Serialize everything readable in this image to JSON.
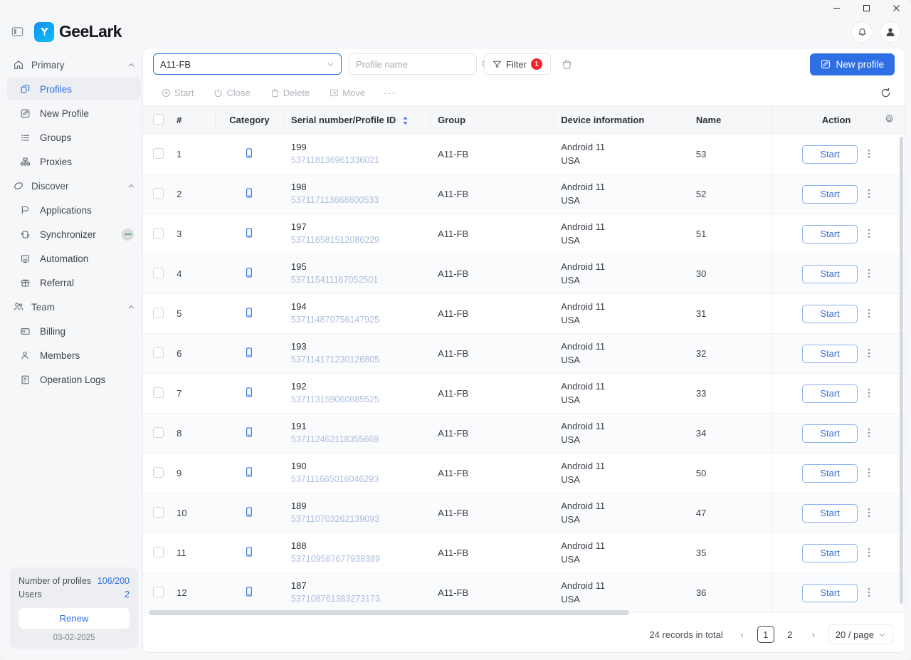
{
  "window": {
    "minimize": "minimize-icon",
    "maximize": "maximize-icon",
    "close": "close-icon"
  },
  "header": {
    "panel_toggle_icon": "panel-toggle-icon",
    "brand": "GeeLark",
    "notifications_icon": "bell-icon",
    "account_icon": "user-icon"
  },
  "sidebar": {
    "groups": [
      {
        "label": "Primary",
        "icon": "home-icon",
        "expanded": true,
        "items": [
          {
            "label": "Profiles",
            "icon": "profiles-icon",
            "active": true
          },
          {
            "label": "New Profile",
            "icon": "new-profile-icon",
            "active": false
          },
          {
            "label": "Groups",
            "icon": "groups-icon",
            "active": false
          },
          {
            "label": "Proxies",
            "icon": "proxies-icon",
            "active": false
          }
        ]
      },
      {
        "label": "Discover",
        "icon": "discover-icon",
        "expanded": true,
        "items": [
          {
            "label": "Applications",
            "icon": "applications-icon",
            "active": false
          },
          {
            "label": "Synchronizer",
            "icon": "synchronizer-icon",
            "active": false,
            "badge": "sync-status-badge"
          },
          {
            "label": "Automation",
            "icon": "automation-icon",
            "active": false
          },
          {
            "label": "Referral",
            "icon": "referral-icon",
            "active": false
          }
        ]
      },
      {
        "label": "Team",
        "icon": "team-icon",
        "expanded": true,
        "items": [
          {
            "label": "Billing",
            "icon": "billing-icon",
            "active": false
          },
          {
            "label": "Members",
            "icon": "members-icon",
            "active": false
          },
          {
            "label": "Operation Logs",
            "icon": "operation-logs-icon",
            "active": false
          }
        ]
      }
    ],
    "quota": {
      "profiles_label": "Number of profiles",
      "profiles_value": "106/200",
      "users_label": "Users",
      "users_value": "2",
      "renew_label": "Renew",
      "expiry_date": "03-02-2025"
    }
  },
  "toolbar": {
    "group_filter_value": "A11-FB",
    "profile_name_placeholder": "Profile name",
    "profile_name_value": "",
    "search_icon": "search-icon",
    "filter_label": "Filter",
    "filter_count": "1",
    "filter_icon": "filter-icon",
    "recycle_icon": "recycle-bin-icon",
    "new_profile_label": "New profile",
    "new_profile_icon": "edit-square-icon"
  },
  "actions": {
    "items": [
      {
        "label": "Start",
        "icon": "play-circle-icon"
      },
      {
        "label": "Close",
        "icon": "power-icon"
      },
      {
        "label": "Delete",
        "icon": "trash-icon"
      },
      {
        "label": "Move",
        "icon": "move-icon"
      }
    ],
    "more": "···",
    "refresh_icon": "refresh-icon"
  },
  "table": {
    "columns": [
      "#",
      "Category",
      "Serial number/Profile ID",
      "Group",
      "Device information",
      "Name",
      "Action"
    ],
    "sort_icon": "sort-arrows-icon",
    "settings_icon": "gear-icon",
    "row_start_label": "Start",
    "row_menu_icon": "kebab-menu-icon",
    "category_icon": "phone-icon",
    "rows": [
      {
        "num": "1",
        "serial": "199",
        "profile_id": "537118136961336021",
        "group": "A11-FB",
        "os": "Android 11",
        "country": "USA",
        "name": "53"
      },
      {
        "num": "2",
        "serial": "198",
        "profile_id": "537117113668600533",
        "group": "A11-FB",
        "os": "Android 11",
        "country": "USA",
        "name": "52"
      },
      {
        "num": "3",
        "serial": "197",
        "profile_id": "537116581512086229",
        "group": "A11-FB",
        "os": "Android 11",
        "country": "USA",
        "name": "51"
      },
      {
        "num": "4",
        "serial": "195",
        "profile_id": "537115411167052501",
        "group": "A11-FB",
        "os": "Android 11",
        "country": "USA",
        "name": "30"
      },
      {
        "num": "5",
        "serial": "194",
        "profile_id": "537114870756147925",
        "group": "A11-FB",
        "os": "Android 11",
        "country": "USA",
        "name": "31"
      },
      {
        "num": "6",
        "serial": "193",
        "profile_id": "537114171230126805",
        "group": "A11-FB",
        "os": "Android 11",
        "country": "USA",
        "name": "32"
      },
      {
        "num": "7",
        "serial": "192",
        "profile_id": "537113159060685525",
        "group": "A11-FB",
        "os": "Android 11",
        "country": "USA",
        "name": "33"
      },
      {
        "num": "8",
        "serial": "191",
        "profile_id": "537112462118355669",
        "group": "A11-FB",
        "os": "Android 11",
        "country": "USA",
        "name": "34"
      },
      {
        "num": "9",
        "serial": "190",
        "profile_id": "537111665016046293",
        "group": "A11-FB",
        "os": "Android 11",
        "country": "USA",
        "name": "50"
      },
      {
        "num": "10",
        "serial": "189",
        "profile_id": "537110703262139093",
        "group": "A11-FB",
        "os": "Android 11",
        "country": "USA",
        "name": "47"
      },
      {
        "num": "11",
        "serial": "188",
        "profile_id": "537109587677938389",
        "group": "A11-FB",
        "os": "Android 11",
        "country": "USA",
        "name": "35"
      },
      {
        "num": "12",
        "serial": "187",
        "profile_id": "537108761383273173",
        "group": "A11-FB",
        "os": "Android 11",
        "country": "USA",
        "name": "36"
      }
    ]
  },
  "footer": {
    "records_total": "24 records in total",
    "prev": "‹",
    "next": "›",
    "pages": [
      "1",
      "2"
    ],
    "current_page": "1",
    "page_size": "20 / page"
  },
  "colors": {
    "accent": "#2f6fe4",
    "badge_red": "#f5222d",
    "profile_id": "#aebde0"
  }
}
